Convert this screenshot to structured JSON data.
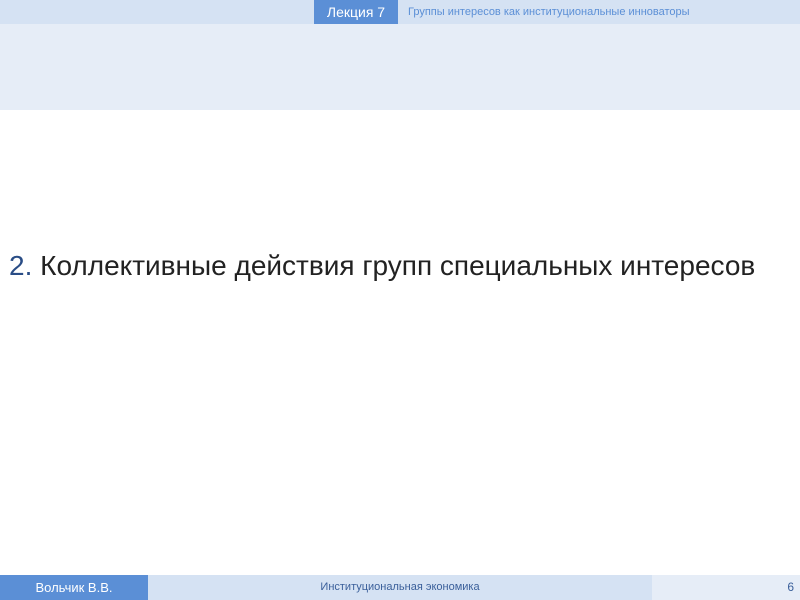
{
  "header": {
    "lecture": "Лекция 7",
    "topic": "Группы интересов как институциональные инноваторы"
  },
  "slide": {
    "number": "2.",
    "heading": "Коллективные действия групп специальных интересов"
  },
  "footer": {
    "author": "Вольчик В.В.",
    "course": "Институциональная экономика",
    "page": "6"
  },
  "colors": {
    "accent": "#5b8fd6",
    "light_band": "#d5e2f3",
    "pale_band": "#e6edf7"
  }
}
